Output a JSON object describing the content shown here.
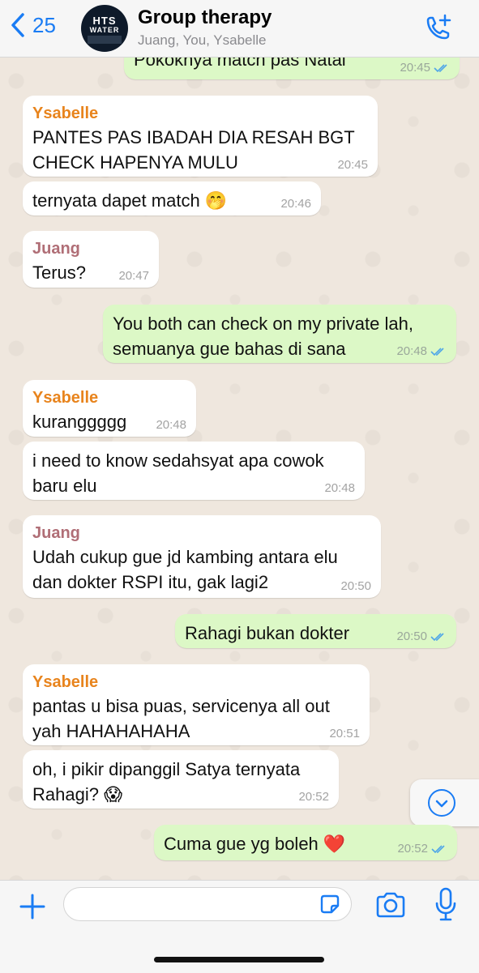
{
  "header": {
    "back_count": "25",
    "title": "Group therapy",
    "subtitle": "Juang, You, Ysabelle",
    "avatar_text_1": "HTS",
    "avatar_text_2": "WATER"
  },
  "messages": [
    {
      "dir": "out",
      "sender": "",
      "text": "Pokoknya match pas Natal",
      "time": "20:45"
    },
    {
      "dir": "in",
      "sender": "Ysabelle",
      "text": "PANTES PAS IBADAH DIA RESAH BGT\nCHECK HAPENYA MULU",
      "time": "20:45"
    },
    {
      "dir": "in",
      "sender": "",
      "text": "ternyata dapet match",
      "emoji": "🤭",
      "time": "20:46"
    },
    {
      "dir": "in",
      "sender": "Juang",
      "text": "Terus?",
      "time": "20:47"
    },
    {
      "dir": "out",
      "sender": "",
      "text": "You both can check on my private lah,\nsemuanya gue bahas di sana",
      "time": "20:48"
    },
    {
      "dir": "in",
      "sender": "Ysabelle",
      "text": "kuranggggg",
      "time": "20:48"
    },
    {
      "dir": "in",
      "sender": "",
      "text": "i need to know sedahsyat apa cowok\nbaru elu",
      "time": "20:48"
    },
    {
      "dir": "in",
      "sender": "Juang",
      "text": "Udah cukup gue jd kambing antara elu\ndan dokter RSPI itu, gak lagi2",
      "time": "20:50"
    },
    {
      "dir": "out",
      "sender": "",
      "text": "Rahagi bukan dokter",
      "time": "20:50"
    },
    {
      "dir": "in",
      "sender": "Ysabelle",
      "text": "pantas u bisa puas, servicenya all out\nyah HAHAHAHAHA",
      "time": "20:51"
    },
    {
      "dir": "in",
      "sender": "",
      "text": "oh, i pikir dipanggil Satya ternyata\nRahagi?",
      "emoji": "😱",
      "time": "20:52"
    },
    {
      "dir": "out",
      "sender": "",
      "text": "Cuma gue yg boleh",
      "emoji": "❤️",
      "time": "20:52"
    }
  ],
  "colors": {
    "accent": "#1A7CF4",
    "outgoing_bubble": "#DCF8C6",
    "incoming_bubble": "#FFFFFF",
    "sender_ysabelle": "#E8841D",
    "sender_juang": "#B06E76",
    "read_ticks": "#4FA6E8"
  },
  "icons": [
    "chevron-left-icon",
    "add-call-icon",
    "plus-icon",
    "sticker-icon",
    "camera-icon",
    "microphone-icon",
    "chevron-down-icon",
    "double-check-icon"
  ]
}
